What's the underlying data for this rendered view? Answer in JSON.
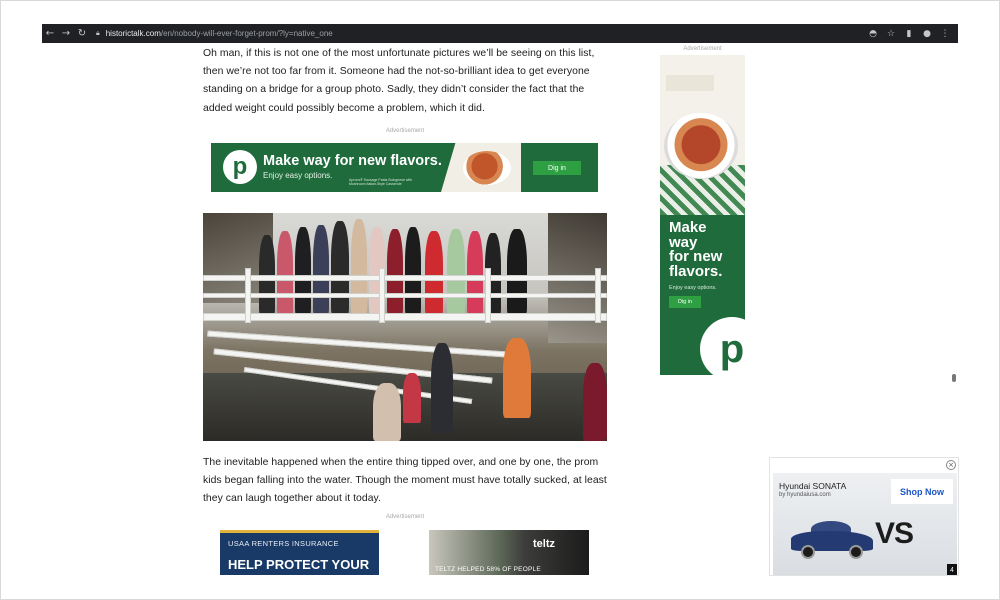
{
  "browser": {
    "url_host": "historictalk.com",
    "url_path": "/en/nobody-will-ever-forget-prom/?ly=native_one"
  },
  "article": {
    "paragraph_1": "Oh man, if this is not one of the most unfortunate pictures we’ll be seeing on this list, then we’re not too far from it. Someone had the not-so-brilliant idea to get everyone standing on a bridge for a group photo. Sadly, they didn’t consider the fact that the added weight could possibly become a problem, which it did.",
    "paragraph_2": "The inevitable happened when the entire thing tipped over, and one by one, the prom kids began falling into the water. Though the moment must have totally sucked, at least they can laugh together about it today."
  },
  "ad_label": "Advertisement",
  "publix_banner": {
    "logo_letter": "p",
    "title": "Make way for new flavors.",
    "subtitle": "Enjoy easy options.",
    "fine_print": "Aprons® Sausage Pasta Bolognese with Mushroom Italian-Style Casserole",
    "cta": "Dig in"
  },
  "publix_skyscraper": {
    "headline": "Make\nway\nfor new\nflavors.",
    "subtitle": "Enjoy easy options.",
    "cta": "Dig in",
    "logo_letter": "p"
  },
  "hyundai_ad": {
    "title": "Hyundai SONATA",
    "url": "by hyundaiusa.com",
    "cta": "Shop Now",
    "vs_text": "VS",
    "badge": "4",
    "close": "×"
  },
  "usaa_ad": {
    "small": "USAA RENTERS INSURANCE",
    "big": "HELP PROTECT YOUR"
  },
  "telt_ad": {
    "logo": "teltz",
    "caption": "TELTZ HELPED 58% OF PEOPLE"
  }
}
